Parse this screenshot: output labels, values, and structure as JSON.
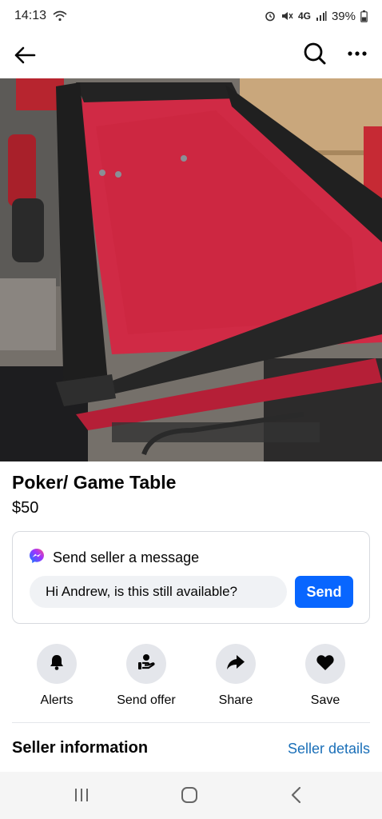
{
  "status": {
    "time": "14:13",
    "network": "4G",
    "battery": "39%"
  },
  "icons": {
    "wifi": "wifi-icon",
    "alarm": "alarm-icon",
    "mute": "mute-icon",
    "signal": "signal-icon",
    "battery": "battery-icon",
    "back": "back-arrow-icon",
    "search": "search-icon",
    "more": "more-icon",
    "messenger": "messenger-icon",
    "alerts": "bell-icon",
    "offer": "hand-coin-icon",
    "share": "share-arrow-icon",
    "save": "heart-icon"
  },
  "listing": {
    "title": "Poker/ Game Table",
    "price": "$50"
  },
  "message": {
    "header": "Send seller a message",
    "input_value": "Hi Andrew, is this still available?",
    "send_label": "Send"
  },
  "actions": [
    {
      "label": "Alerts"
    },
    {
      "label": "Send offer"
    },
    {
      "label": "Share"
    },
    {
      "label": "Save"
    }
  ],
  "seller": {
    "title": "Seller information",
    "details_link": "Seller details"
  },
  "colors": {
    "accent": "#0866ff",
    "link": "#1a6fb8",
    "felt": "#d02a45"
  }
}
